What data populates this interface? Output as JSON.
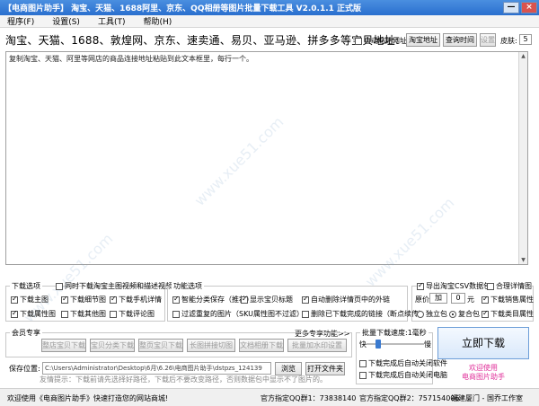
{
  "window": {
    "title": "【电商图片助手】 淘宝、天猫、1688阿里、京东、QQ相册等图片批量下载工具 V2.0.1.1 正式版",
    "minimize": "—",
    "close": "×"
  },
  "menu": [
    "程序(F)",
    "设置(S)",
    "工具(T)",
    "帮助(H)"
  ],
  "urlbar": {
    "label": "淘宝、天猫、1688、敦煌网、京东、速卖通、易贝、亚马逊、拼多多等宝贝地址:",
    "auto_paste": "自动粘贴网址",
    "btn_locate": "淘宝地址",
    "btn_query": "查询时间",
    "btn_settings": "设置",
    "skin_label": "皮肤:",
    "skin_value": "5"
  },
  "textarea": {
    "placeholder": "复制淘宝、天猫、阿里等网店的商品连接地址粘贴到此文本框里，每行一个。"
  },
  "download_options": {
    "title": "下载选项",
    "items": [
      {
        "label": "同时下载淘宝主图视频和描述视频",
        "checked": false
      },
      {
        "label": "下载主图",
        "checked": true
      },
      {
        "label": "下载细节图",
        "checked": true
      },
      {
        "label": "下载手机详情",
        "checked": true
      },
      {
        "label": "下载属性图",
        "checked": true
      },
      {
        "label": "下载其他图",
        "checked": false
      },
      {
        "label": "下载评论图",
        "checked": false
      }
    ]
  },
  "function_options": {
    "title": "功能选项",
    "items": [
      {
        "label": "智能分类保存（推荐）",
        "checked": true
      },
      {
        "label": "显示宝贝标题",
        "checked": true
      },
      {
        "label": "自动删除详情页中的外链",
        "checked": true
      },
      {
        "label": "过滤重复的图片（SKU属性图不过滤）",
        "checked": false
      },
      {
        "label": "删除已下载完成的链接（断点续传）",
        "checked": false
      }
    ],
    "more": "更多专享功能>>"
  },
  "csv_options": {
    "items": [
      {
        "label": "导出淘宝CSV数据包",
        "checked": true
      },
      {
        "label": "合理详情图",
        "checked": false
      },
      {
        "label": "下载销售属性",
        "checked": true
      },
      {
        "label": "下载类目属性",
        "checked": true
      }
    ],
    "price_label": "原价",
    "price_op": "加",
    "price_value": "0",
    "price_unit": "元",
    "radio_single": "独立包",
    "radio_merge": "复合包"
  },
  "member": {
    "title": "会员专享",
    "buttons": [
      "整店宝贝下载",
      "宝贝分类下载",
      "整页宝贝下载",
      "长图拼接切图",
      "文档相册下载",
      "批量加水印设置"
    ]
  },
  "batch_speed": {
    "title": "批量下载速度:",
    "value": "1毫秒",
    "fast": "快",
    "slow": "慢",
    "level": 0.2,
    "close_soft": "下载完成后自动关闭软件",
    "shutdown": "下载完成后自动关闭电脑"
  },
  "save": {
    "label": "保存位置:",
    "path": "C:\\Users\\Administrator\\Desktop\\6月\\6.26\\电商图片助手\\dstpzs_124139",
    "browse": "浏览",
    "open": "打开文件夹",
    "hint": "友情提示：下载前请先选择好路径，下载后不要改变路径，否则数据包中显示不了图片的。"
  },
  "download_button": "立即下载",
  "welcome": [
    "欢迎使用",
    "电商图片助手"
  ],
  "status": {
    "welcome": "欢迎使用《电商图片助手》快速打造您的网站商城!",
    "qq1": "官方指定QQ群1：73838140",
    "qq2": "官方指定QQ群2：757154006",
    "author": "福建厦门 - 国乔工作室"
  }
}
